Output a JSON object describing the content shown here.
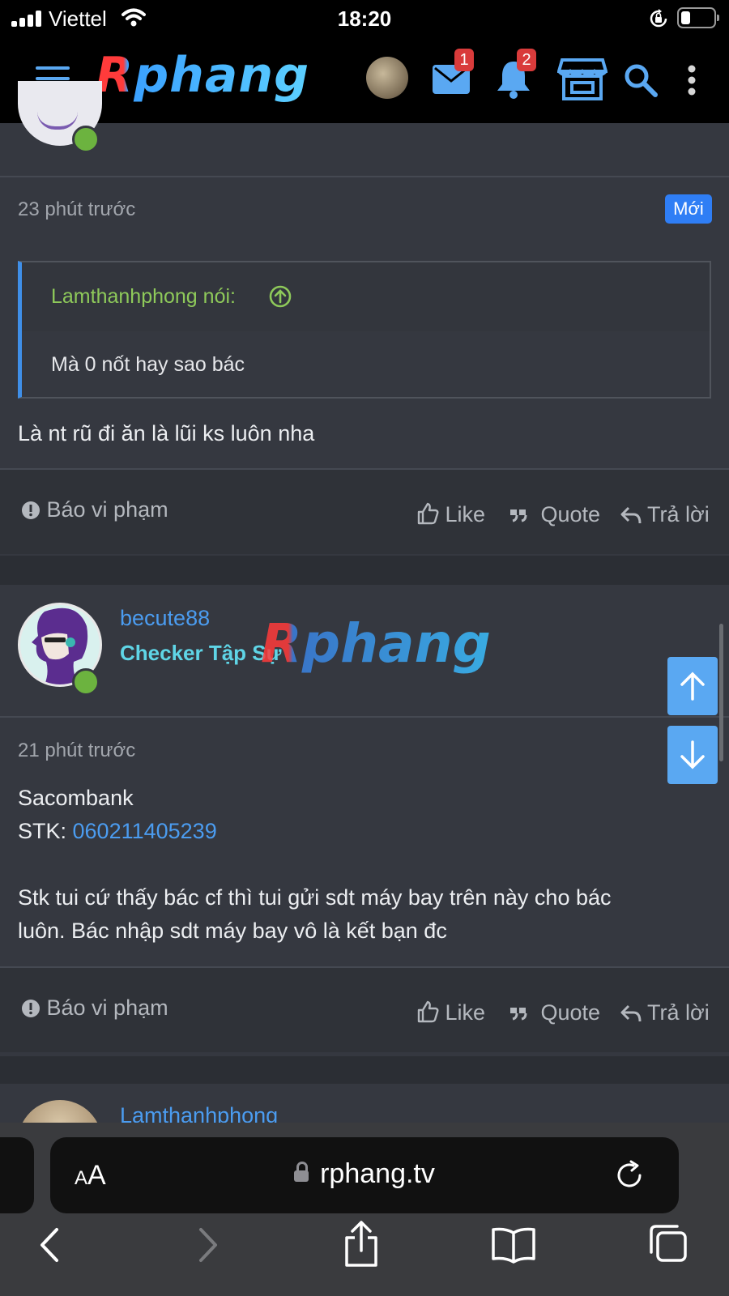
{
  "status_bar": {
    "carrier": "Viettel",
    "time": "18:20"
  },
  "app_nav": {
    "logo": "Rphang",
    "icons": [
      "menu-icon",
      "avatar",
      "mail-icon",
      "bell-icon",
      "store-icon",
      "search-icon",
      "more-icon"
    ],
    "mail_count": "1",
    "bell_count": "2"
  },
  "post1": {
    "time": "23 phút trước",
    "new_badge": "Mới",
    "quote_author": "Lamthanhphong nói:",
    "quote_text": "Mà 0 nốt hay sao bác",
    "text": "Là nt rũ đi ăn là lũi ks luôn nha"
  },
  "actions": {
    "report": "Báo vi phạm",
    "like": "Like",
    "quote": "Quote",
    "reply": "Trả lời"
  },
  "post2": {
    "username": "becute88",
    "user_title": "Checker Tập Sự",
    "watermark": "Rphang",
    "time": "21 phút trước",
    "line1": "Sacombank",
    "stk_label": "STK: ",
    "stk_number": "060211405239",
    "line3": "Stk tui cứ thấy bác cf thì tui gửi sdt máy bay trên này cho bác",
    "line4": "luôn. Bác nhập sdt máy bay vô là kết bạn đc"
  },
  "post3": {
    "username": "Lamthanhphong"
  },
  "safari": {
    "aa_small": "A",
    "aa_large": "A",
    "url": "rphang.tv"
  },
  "colors": {
    "accent": "#4b9cf0",
    "new_badge": "#2f7ef5",
    "quote_author": "#8ec95a",
    "user_title": "#5fd5e6",
    "online": "#6cb33f",
    "scroll_btn": "#5aa8f2"
  }
}
